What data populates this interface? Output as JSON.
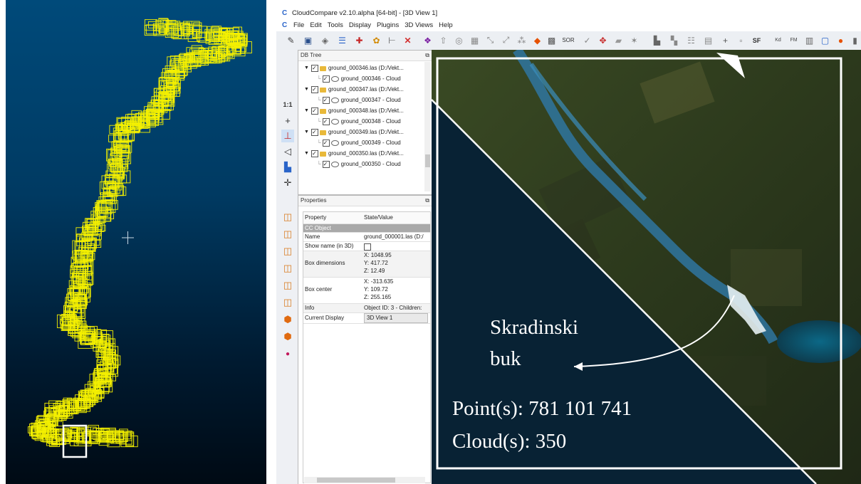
{
  "window": {
    "title": "CloudCompare v2.10.alpha [64-bit] - [3D View 1]"
  },
  "menu": [
    "File",
    "Edit",
    "Tools",
    "Display",
    "Plugins",
    "3D Views",
    "Help"
  ],
  "toolbar": {
    "sor_label": "SOR",
    "sf_label": "SF",
    "kd_label": "Kd",
    "fm_label": "FM"
  },
  "toolcol": {
    "scale_label": "1:1"
  },
  "db_tree": {
    "title": "DB Tree",
    "items": [
      {
        "file": "ground_000346.las (D:/Vekt...",
        "cloud": "ground_000346 - Cloud"
      },
      {
        "file": "ground_000347.las (D:/Vekt...",
        "cloud": "ground_000347 - Cloud"
      },
      {
        "file": "ground_000348.las (D:/Vekt...",
        "cloud": "ground_000348 - Cloud"
      },
      {
        "file": "ground_000349.las (D:/Vekt...",
        "cloud": "ground_000349 - Cloud"
      },
      {
        "file": "ground_000350.las (D:/Vekt...",
        "cloud": "ground_000350 - Cloud"
      }
    ]
  },
  "properties": {
    "title": "Properties",
    "col_property": "Property",
    "col_value": "State/Value",
    "section": "CC Object",
    "name_label": "Name",
    "name_value": "ground_000001.las (D:/",
    "show_name_label": "Show name (in 3D)",
    "box_dim_label": "Box dimensions",
    "box_dim": [
      "X: 1048.95",
      "Y: 417.72",
      "Z: 12.49"
    ],
    "box_center_label": "Box center",
    "box_center": [
      "X: -313.635",
      "Y: 109.72",
      "Z: 255.165"
    ],
    "info_label": "Info",
    "info_value": "Object ID: 3 - Children:",
    "current_display_label": "Current Display",
    "current_display_value": "3D View 1"
  },
  "view3d": {
    "place_label_line1": "Skradinski",
    "place_label_line2": "buk",
    "points": "Point(s): 781 101 741",
    "clouds": "Cloud(s): 350"
  },
  "colors": {
    "tile_outline": "#f4f000",
    "background_blue": "#004a7a",
    "folder": "#e9b93a"
  }
}
